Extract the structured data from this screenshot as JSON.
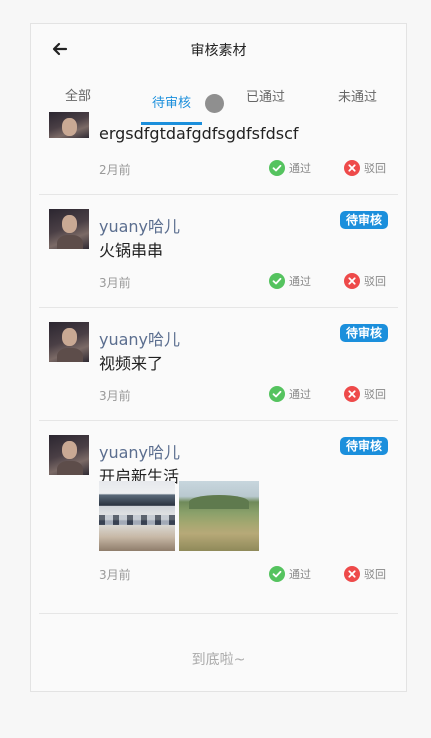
{
  "header": {
    "title": "审核素材",
    "back_icon": "arrow-left-icon"
  },
  "tabs": [
    {
      "label": "全部",
      "active": false
    },
    {
      "label": "待审核",
      "active": true
    },
    {
      "label": "已通过",
      "active": false
    },
    {
      "label": "未通过",
      "active": false
    }
  ],
  "items": [
    {
      "content": "ergsdfgtdafgdfsgdfsfdscf",
      "time": "2月前",
      "approve": "通过",
      "reject": "驳回"
    },
    {
      "username": "yuany哈儿",
      "badge": "待审核",
      "content": "火锅串串",
      "time": "3月前",
      "approve": "通过",
      "reject": "驳回"
    },
    {
      "username": "yuany哈儿",
      "badge": "待审核",
      "content": "视频来了",
      "time": "3月前",
      "approve": "通过",
      "reject": "驳回"
    },
    {
      "username": "yuany哈儿",
      "badge": "待审核",
      "content": "开启新生活",
      "time": "3月前",
      "approve": "通过",
      "reject": "驳回"
    }
  ],
  "footer": "到底啦~",
  "colors": {
    "accent": "#1b8fdc",
    "approve": "#55c35f",
    "reject": "#ee4a4a"
  }
}
